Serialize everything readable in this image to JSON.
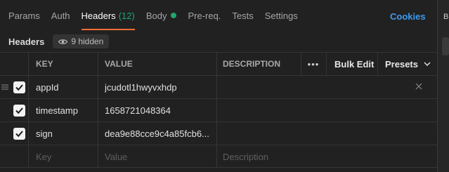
{
  "tabs": [
    {
      "label": "Params"
    },
    {
      "label": "Auth"
    },
    {
      "label": "Headers",
      "count": "(12)",
      "active": true
    },
    {
      "label": "Body"
    },
    {
      "label": "Pre-req."
    },
    {
      "label": "Tests"
    },
    {
      "label": "Settings"
    }
  ],
  "cookies_label": "Cookies",
  "right_panel_letter": "B",
  "subbar": {
    "label": "Headers",
    "hidden_label": "9 hidden"
  },
  "table": {
    "headers": {
      "key": "KEY",
      "value": "VALUE",
      "description": "DESCRIPTION",
      "more": "•••",
      "bulk_edit": "Bulk Edit",
      "presets": "Presets"
    },
    "rows": [
      {
        "key": "appId",
        "value": "jcudotl1hwyvxhdp",
        "description": "",
        "checked": true
      },
      {
        "key": "timestamp",
        "value": "1658721048364",
        "description": "",
        "checked": true
      },
      {
        "key": "sign",
        "value": "dea9e88cce9c4a85fcb6...",
        "description": "",
        "checked": true
      }
    ],
    "placeholders": {
      "key": "Key",
      "value": "Value",
      "description": "Description"
    }
  },
  "colors": {
    "accent": "#ff6c37",
    "success": "#21a66e",
    "link": "#3b9bf0",
    "background": "#212121"
  }
}
